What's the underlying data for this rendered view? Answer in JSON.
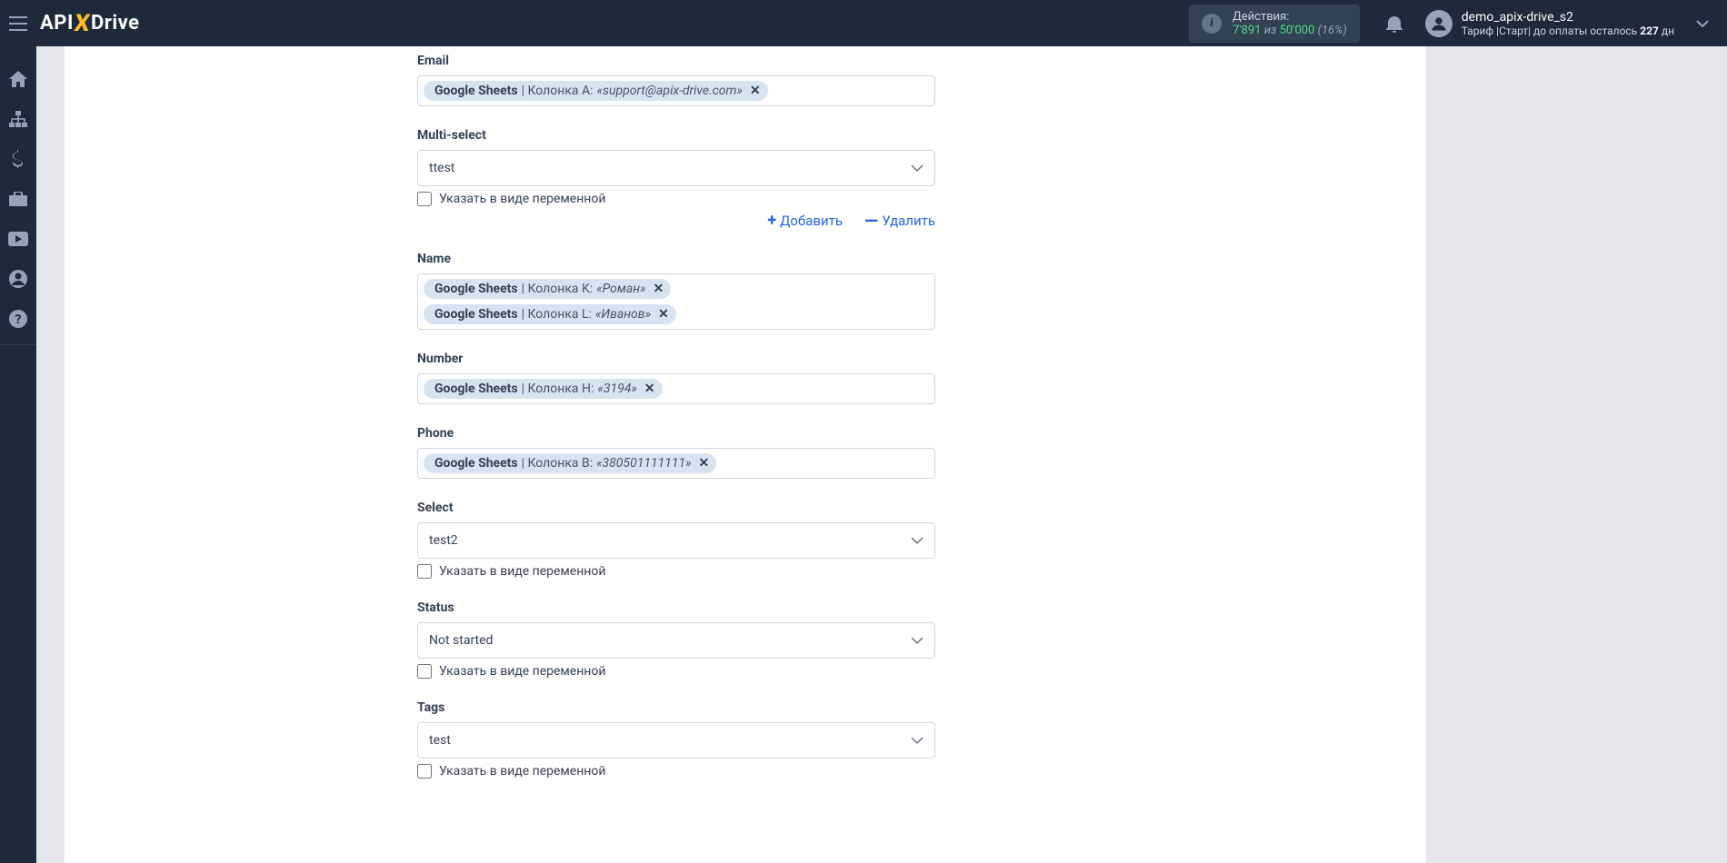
{
  "brand": {
    "part1": "API",
    "x": "X",
    "part2": "Drive"
  },
  "header": {
    "actions_label": "Действия:",
    "count": "7'891",
    "of": "из",
    "limit": "50'000",
    "pct": "(16%)"
  },
  "user": {
    "name": "demo_apix-drive_s2",
    "tariff_prefix": "Тариф |Старт| до оплаты осталось ",
    "days": "227",
    "days_suffix": " дн"
  },
  "labels": {
    "checkbox_var": "Указать в виде переменной",
    "add": "Добавить",
    "delete": "Удалить"
  },
  "fields": {
    "email": {
      "label": "Email",
      "chips": [
        {
          "source": "Google Sheets",
          "column": " | Колонка A: ",
          "value": "«support@apix-drive.com»"
        }
      ]
    },
    "multiselect": {
      "label": "Multi-select",
      "value": "ttest"
    },
    "name": {
      "label": "Name",
      "chips": [
        {
          "source": "Google Sheets",
          "column": " | Колонка K: ",
          "value": "«Роман»"
        },
        {
          "source": "Google Sheets",
          "column": " | Колонка L: ",
          "value": "«Иванов»"
        }
      ]
    },
    "number": {
      "label": "Number",
      "chips": [
        {
          "source": "Google Sheets",
          "column": " | Колонка H: ",
          "value": "«3194»"
        }
      ]
    },
    "phone": {
      "label": "Phone",
      "chips": [
        {
          "source": "Google Sheets",
          "column": " | Колонка B: ",
          "value": "«380501111111»"
        }
      ]
    },
    "select": {
      "label": "Select",
      "value": "test2"
    },
    "status": {
      "label": "Status",
      "value": "Not started"
    },
    "tags": {
      "label": "Tags",
      "value": "test"
    }
  }
}
